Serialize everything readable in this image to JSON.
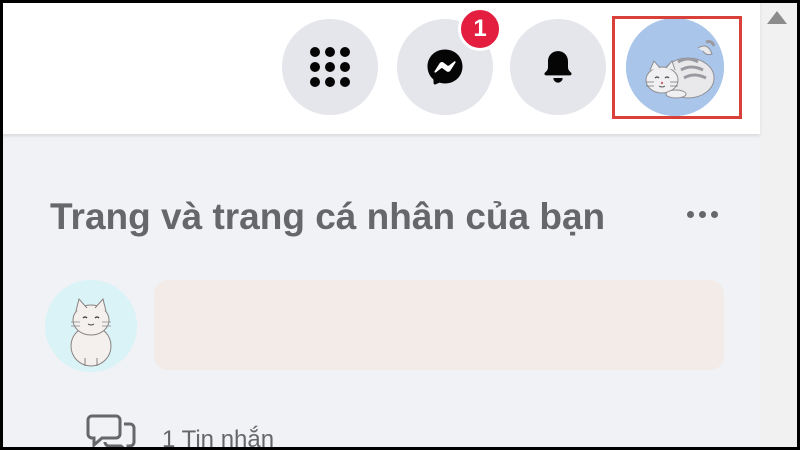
{
  "header": {
    "menu_icon": "grid-menu-icon",
    "messenger_icon": "messenger-icon",
    "messenger_badge": "1",
    "notifications_icon": "bell-icon",
    "profile_avatar": "cat-avatar",
    "highlight_color": "#d9403a",
    "badge_color": "#e41e3f"
  },
  "section": {
    "title": "Trang và trang cá nhân của bạn",
    "more_icon": "more-options-icon",
    "page_avatar": "cat-avatar"
  },
  "messages": {
    "icon": "message-bubbles-icon",
    "label": "1 Tin nhắn"
  }
}
